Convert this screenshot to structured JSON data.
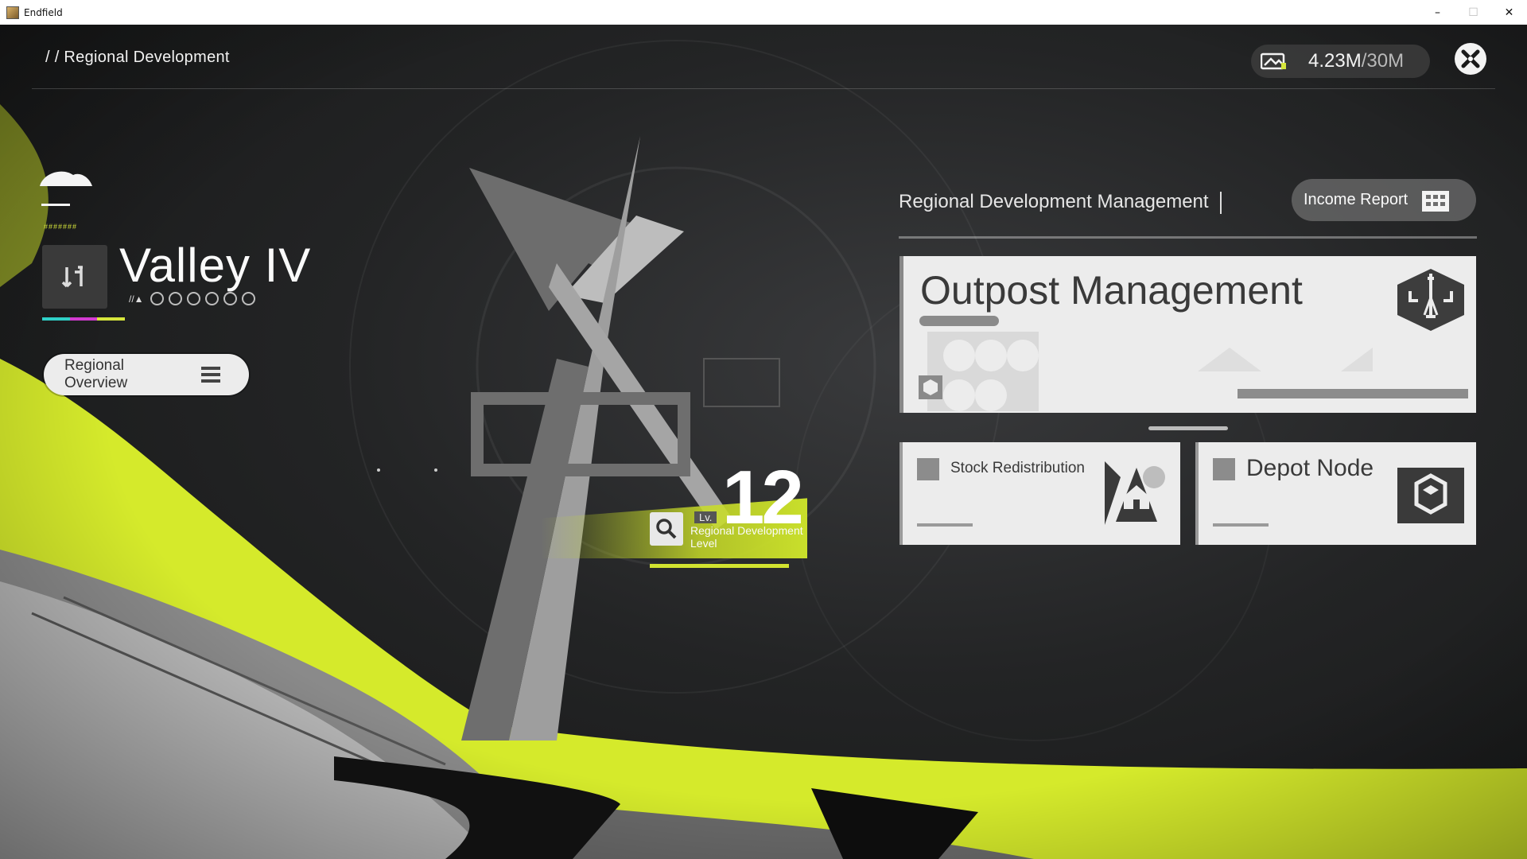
{
  "window": {
    "app_title": "Endfield",
    "minimize": "–",
    "maximize": "☐",
    "close": "✕"
  },
  "header": {
    "breadcrumb": "/ / Regional Development",
    "currency_current": "4.23M",
    "currency_max": "/30M",
    "currency_icon": "ticket-icon",
    "close_icon": "close-circle-icon"
  },
  "region": {
    "name": "Valley IV",
    "hashes": "#######",
    "marker": "//▲",
    "dots_count": 6,
    "weather_icon": "cloud-icon",
    "badge_icon": "arrows-icon",
    "color_line": [
      "#2fd0c7",
      "#d23bd0",
      "#d7e63c"
    ],
    "overview_button": "Regional Overview",
    "overview_icon": "menu-icon"
  },
  "level": {
    "value": "12",
    "prefix": "Lv.",
    "label": "Regional Development Level",
    "accent": "#d2e330"
  },
  "management": {
    "title": "Regional Development Management",
    "income_button": "Income Report",
    "income_icon": "building-icon",
    "main_card": {
      "title": "Outpost Management",
      "icon": "outpost-icon"
    },
    "cards": [
      {
        "name": "Stock Redistribution",
        "icon": "stock-icon"
      },
      {
        "name": "Depot Node",
        "icon": "depot-icon"
      }
    ]
  }
}
